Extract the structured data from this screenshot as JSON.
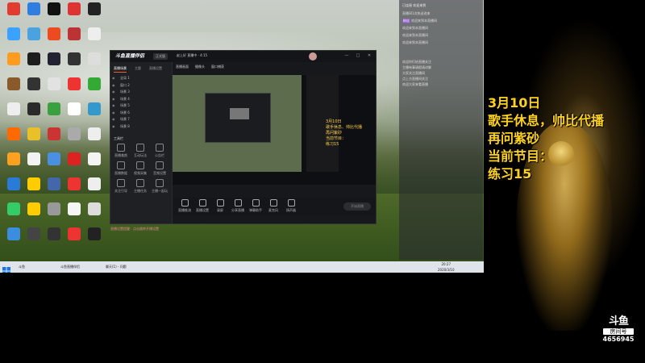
{
  "desktop": {
    "icons": [
      {
        "label": "",
        "color": "#e23b30"
      },
      {
        "label": "",
        "color": "#2f7de1"
      },
      {
        "label": "",
        "color": "#111"
      },
      {
        "label": "",
        "color": "#d33"
      },
      {
        "label": "",
        "color": "#222"
      },
      {
        "label": "",
        "color": "#3aa2ff"
      },
      {
        "label": "",
        "color": "#4aa3e0"
      },
      {
        "label": "",
        "color": "#ee4a1f"
      },
      {
        "label": "",
        "color": "#b33"
      },
      {
        "label": "",
        "color": "#eee"
      },
      {
        "label": "",
        "color": "#ff9b1f"
      },
      {
        "label": "",
        "color": "#1e1e1e"
      },
      {
        "label": "",
        "color": "#223"
      },
      {
        "label": "",
        "color": "#333"
      },
      {
        "label": "",
        "color": "#ddd"
      },
      {
        "label": "",
        "color": "#8b5a2b"
      },
      {
        "label": "",
        "color": "#333"
      },
      {
        "label": "",
        "color": "#e2e2e2"
      },
      {
        "label": "",
        "color": "#e33"
      },
      {
        "label": "",
        "color": "#3a3"
      },
      {
        "label": "",
        "color": "#eee"
      },
      {
        "label": "",
        "color": "#2b2b2b"
      },
      {
        "label": "",
        "color": "#3aa040"
      },
      {
        "label": "",
        "color": "#fff"
      },
      {
        "label": "",
        "color": "#39c"
      },
      {
        "label": "",
        "color": "#ff6a00"
      },
      {
        "label": "",
        "color": "#e8c02a"
      },
      {
        "label": "",
        "color": "#c33"
      },
      {
        "label": "",
        "color": "#aaa"
      },
      {
        "label": "",
        "color": "#eee"
      },
      {
        "label": "",
        "color": "#ffa01e"
      },
      {
        "label": "",
        "color": "#f2f2f2"
      },
      {
        "label": "",
        "color": "#4a90e2"
      },
      {
        "label": "",
        "color": "#d22"
      },
      {
        "label": "",
        "color": "#f3f3f3"
      },
      {
        "label": "",
        "color": "#2a7ad8"
      },
      {
        "label": "",
        "color": "#ffcc00"
      },
      {
        "label": "",
        "color": "#46a"
      },
      {
        "label": "",
        "color": "#e33"
      },
      {
        "label": "",
        "color": "#eee"
      },
      {
        "label": "",
        "color": "#3c6"
      },
      {
        "label": "",
        "color": "#fc0"
      },
      {
        "label": "",
        "color": "#999"
      },
      {
        "label": "",
        "color": "#f5f5f5"
      },
      {
        "label": "",
        "color": "#ddd"
      },
      {
        "label": "",
        "color": "#3b8de0"
      },
      {
        "label": "",
        "color": "#444"
      },
      {
        "label": "",
        "color": "#333"
      },
      {
        "label": "",
        "color": "#e33"
      },
      {
        "label": "",
        "color": "#222"
      }
    ],
    "taskbar": {
      "items": [
        {
          "label": "斗鱼"
        },
        {
          "label": "斗鱼直播伴侣"
        },
        {
          "label": "聊天(1) - 问题"
        }
      ],
      "time": "20:27",
      "date": "2020/3/10"
    }
  },
  "app": {
    "logo": "斗鱼直播伴侣",
    "badge": "正式版",
    "header_info": "赵上好 直播中 · 4:15",
    "window_controls": [
      "—",
      "□",
      "✕"
    ],
    "left_tabs": [
      "直播场景",
      "主题",
      "直播设置"
    ],
    "scenes": [
      "全局 1",
      "窗口 2",
      "场景 3",
      "场景 4",
      "场景 5",
      "场景 6",
      "场景 7",
      "场景 8"
    ],
    "tools_title": "工具栏",
    "tools": [
      {
        "label": "直播美颜"
      },
      {
        "label": "互动玩法"
      },
      {
        "label": "公告栏"
      },
      {
        "label": "直播数据"
      },
      {
        "label": "视频采集"
      },
      {
        "label": "音频设置"
      },
      {
        "label": "关注引导"
      },
      {
        "label": "主播任务"
      },
      {
        "label": "主播一起玩"
      }
    ],
    "notice": "直播设置提醒：点击跳转开播设置",
    "center_tabs": [
      "直播画面",
      "摄像头",
      "窗口捕获"
    ],
    "preview_text": [
      "3月10日",
      "歌手休息、帅比代播",
      "再问紫砂",
      "当前节目：",
      "练习15"
    ],
    "bottom_buttons": [
      "直播推流",
      "直播设置",
      "录屏",
      "分享直播",
      "弹幕助手",
      "麦克风",
      "扬声器"
    ],
    "go_live": "开始直播"
  },
  "chat": {
    "header": "已连接 欢迎来到",
    "lines": [
      {
        "tag": "",
        "tag_style": "",
        "name": "",
        "text": "直播间1次热送进来"
      },
      {
        "tag": "粉丝",
        "tag_style": "p",
        "name": "",
        "text": "欢迎来到本直播间"
      },
      {
        "tag": "",
        "tag_style": "",
        "name": "",
        "text": "欢迎来到本直播间"
      },
      {
        "tag": "",
        "tag_style": "o",
        "name": "",
        "text": "欢迎来到本直播间"
      },
      {
        "tag": "",
        "tag_style": "",
        "name": "",
        "text": "欢迎来到本直播间"
      },
      {
        "tag": "",
        "tag_style": "",
        "name": "",
        "text": "欢迎你们给直播关注"
      },
      {
        "tag": "",
        "tag_style": "",
        "name": "",
        "text": "主播有事请假请谅解"
      },
      {
        "tag": "",
        "tag_style": "",
        "name": "",
        "text": "大家关注直播间"
      },
      {
        "tag": "",
        "tag_style": "",
        "name": "",
        "text": "点上方直播间关注"
      },
      {
        "tag": "",
        "tag_style": "",
        "name": "",
        "text": "欢迎大家来看直播"
      }
    ]
  },
  "overlay": {
    "lines": [
      "3月10日",
      "歌手休息，帅比代播",
      "再问紫砂",
      "当前节目：",
      "练习15"
    ]
  },
  "room": {
    "brand": "斗鱼",
    "label": "房间号",
    "number": "4656945"
  },
  "colors": {
    "overlay_text": "#ffd21f",
    "accent": "#ff5a2a"
  }
}
